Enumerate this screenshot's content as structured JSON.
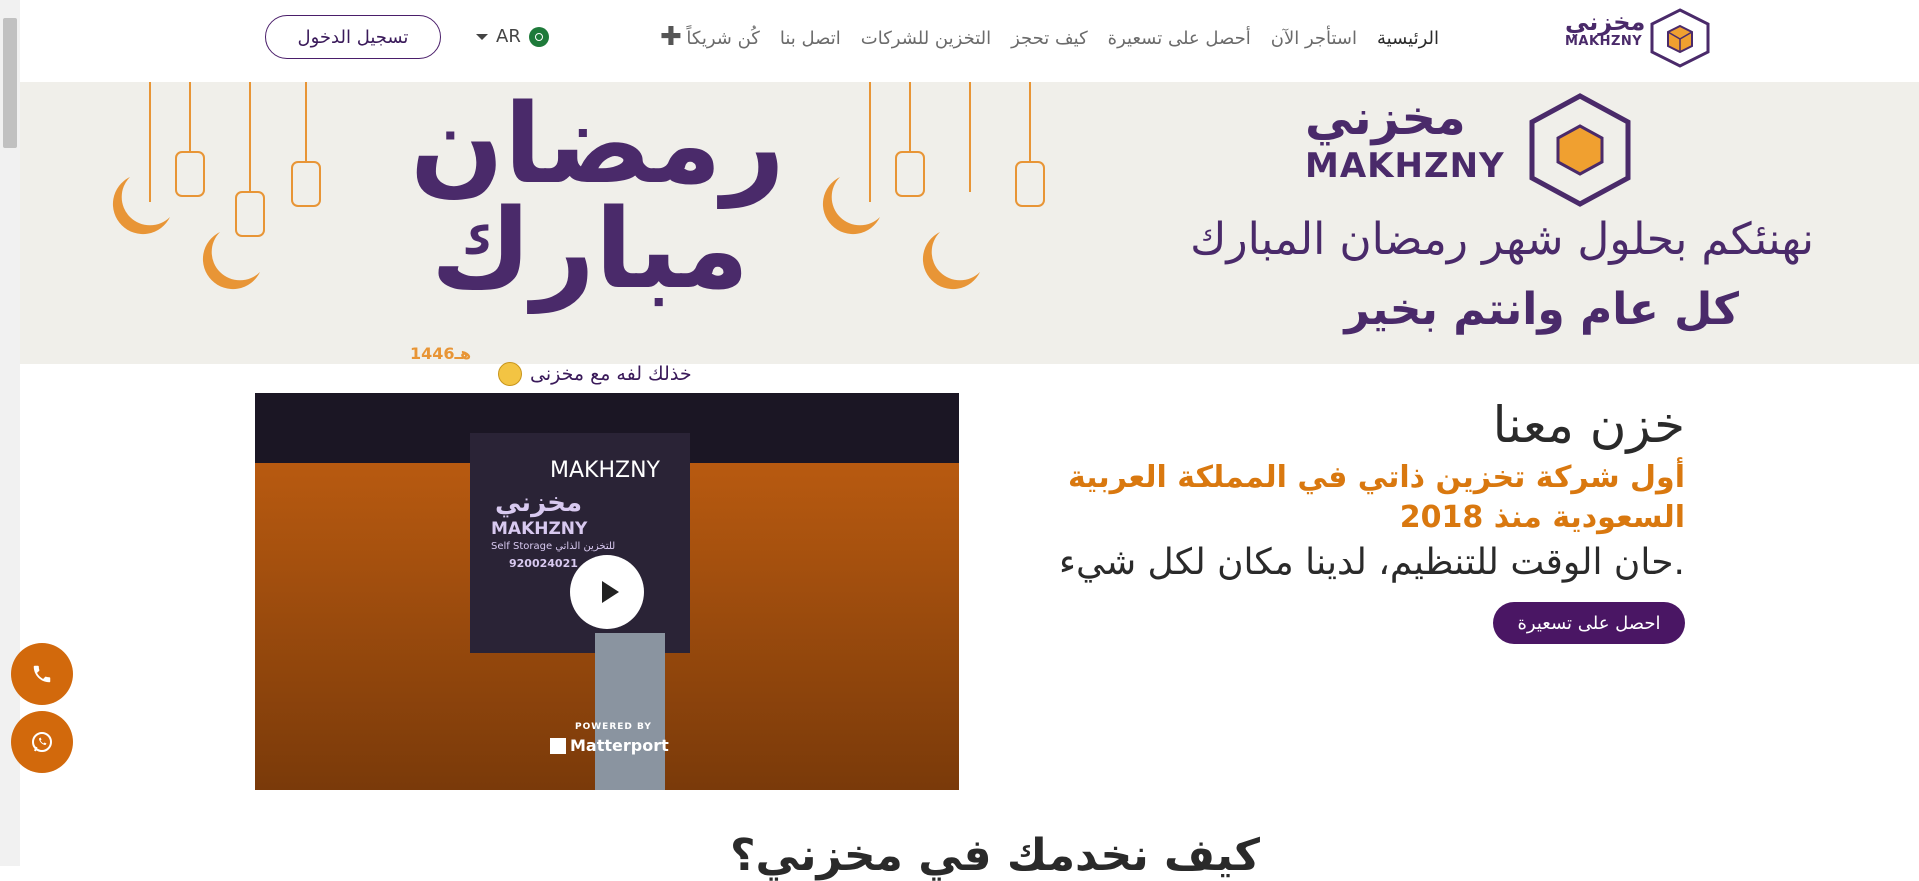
{
  "header": {
    "logo": {
      "ar": "مخزني",
      "en": "MAKHZNY"
    },
    "nav": [
      {
        "label": "الرئيسية",
        "active": true
      },
      {
        "label": "استأجر الآن",
        "active": false
      },
      {
        "label": "أحصل على تسعيرة",
        "active": false
      },
      {
        "label": "كيف تحجز",
        "active": false
      },
      {
        "label": "التخزين للشركات",
        "active": false
      },
      {
        "label": "اتصل بنا",
        "active": false
      },
      {
        "label": "كُن شريكاً",
        "active": false
      }
    ],
    "more_icon": "plus-icon",
    "language": "AR",
    "login_label": "تسجيل الدخول"
  },
  "banner": {
    "ramadan_line1": "رمضان",
    "ramadan_line2": "مبارك",
    "year": "1446هـ",
    "brand_ar": "مخزني",
    "brand_en": "MAKHZNY",
    "line1": "نهنئكم بحلول شهر رمضان المبارك",
    "line2": "كل عام وانتم بخير"
  },
  "caption": "خذلك لفه مع مخزنى",
  "video": {
    "brand": "MAKHZNY",
    "sign_ar": "مخزني",
    "sign_en": "MAKHZNY",
    "sign_sub": "Self Storage للتخزين الذاتي",
    "sign_phone": "920024021",
    "powered_by": "POWERED BY",
    "provider": "Matterport"
  },
  "hero": {
    "title": "خزن معنا",
    "subtitle": "أول شركة تخزين ذاتي في المملكة العربية السعودية منذ 2018",
    "description": "حان الوقت للتنظيم، لدينا مكان لكل شيء.",
    "cta": "احصل على تسعيرة"
  },
  "section_heading": "كيف نخدمك في مخزني؟",
  "colors": {
    "brand_purple": "#4a2a6a",
    "accent_orange": "#d9780f",
    "banner_bg": "#f0efea"
  }
}
